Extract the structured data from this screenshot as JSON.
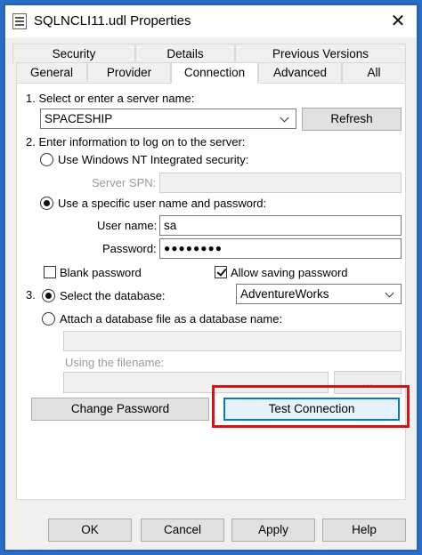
{
  "window": {
    "title": "SQLNCLI11.udl Properties"
  },
  "tabs": {
    "row1": [
      "Security",
      "Details",
      "Previous Versions"
    ],
    "row2": [
      "General",
      "Provider",
      "Connection",
      "Advanced",
      "All"
    ],
    "active": "Connection"
  },
  "connection": {
    "step1_label": "1. Select or enter a server name:",
    "server_name": "SPACESHIP",
    "refresh_label": "Refresh",
    "step2_label": "2. Enter information to log on to the server:",
    "windows_nt_label": "Use Windows NT Integrated security:",
    "server_spn_label": "Server SPN:",
    "server_spn_value": "",
    "specific_user_label": "Use a specific user name and password:",
    "username_label": "User name:",
    "username_value": "sa",
    "password_label": "Password:",
    "password_value": "●●●●●●●●",
    "blank_password_label": "Blank password",
    "blank_password_checked": false,
    "allow_saving_label": "Allow saving password",
    "allow_saving_checked": true,
    "step3_number": "3.",
    "select_db_label": "Select the database:",
    "database_value": "AdventureWorks",
    "attach_db_label": "Attach a database file as a database name:",
    "attach_db_value": "",
    "using_filename_label": "Using the filename:",
    "filename_value": "",
    "browse_label": "...",
    "change_password_label": "Change Password",
    "test_connection_label": "Test Connection"
  },
  "footer": {
    "ok": "OK",
    "cancel": "Cancel",
    "apply": "Apply",
    "help": "Help"
  },
  "colors": {
    "highlight": "#d6121b",
    "accent": "#0078d7",
    "frame": "#2b6cc4"
  }
}
